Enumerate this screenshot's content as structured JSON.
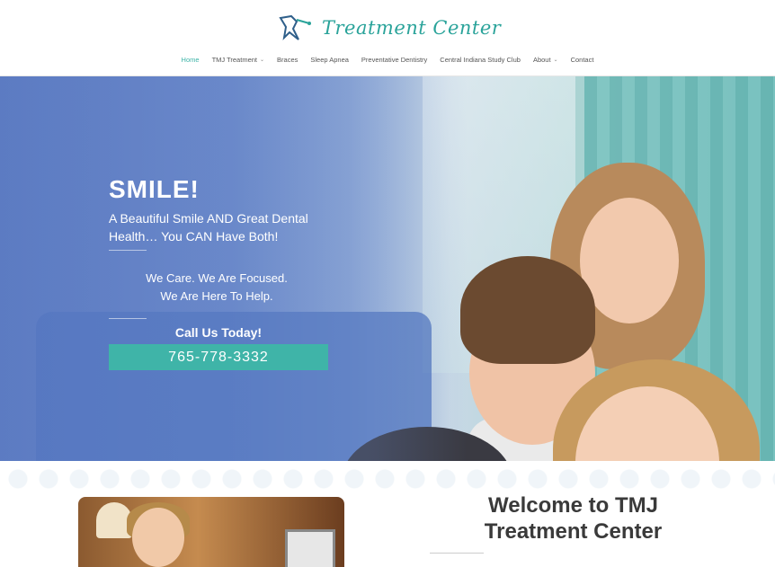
{
  "header": {
    "logo_text": "Treatment Center",
    "nav": [
      {
        "label": "Home",
        "active": true,
        "dropdown": false
      },
      {
        "label": "TMJ Treatment",
        "active": false,
        "dropdown": true
      },
      {
        "label": "Braces",
        "active": false,
        "dropdown": false
      },
      {
        "label": "Sleep Apnea",
        "active": false,
        "dropdown": false
      },
      {
        "label": "Preventative Dentistry",
        "active": false,
        "dropdown": false
      },
      {
        "label": "Central Indiana Study Club",
        "active": false,
        "dropdown": false
      },
      {
        "label": "About",
        "active": false,
        "dropdown": true
      },
      {
        "label": "Contact",
        "active": false,
        "dropdown": false
      }
    ]
  },
  "hero": {
    "headline": "SMILE!",
    "subhead": "A Beautiful Smile AND Great Dental Health… You CAN Have Both!",
    "care_line1": "We Care. We Are Focused.",
    "care_line2": "We Are Here To Help.",
    "call_label": "Call Us Today!",
    "phone": "765-778-3332"
  },
  "welcome": {
    "line1": "Welcome to TMJ",
    "line2": "Treatment Center"
  },
  "colors": {
    "accent": "#3fb4a8",
    "heading": "#3a3a3a"
  }
}
